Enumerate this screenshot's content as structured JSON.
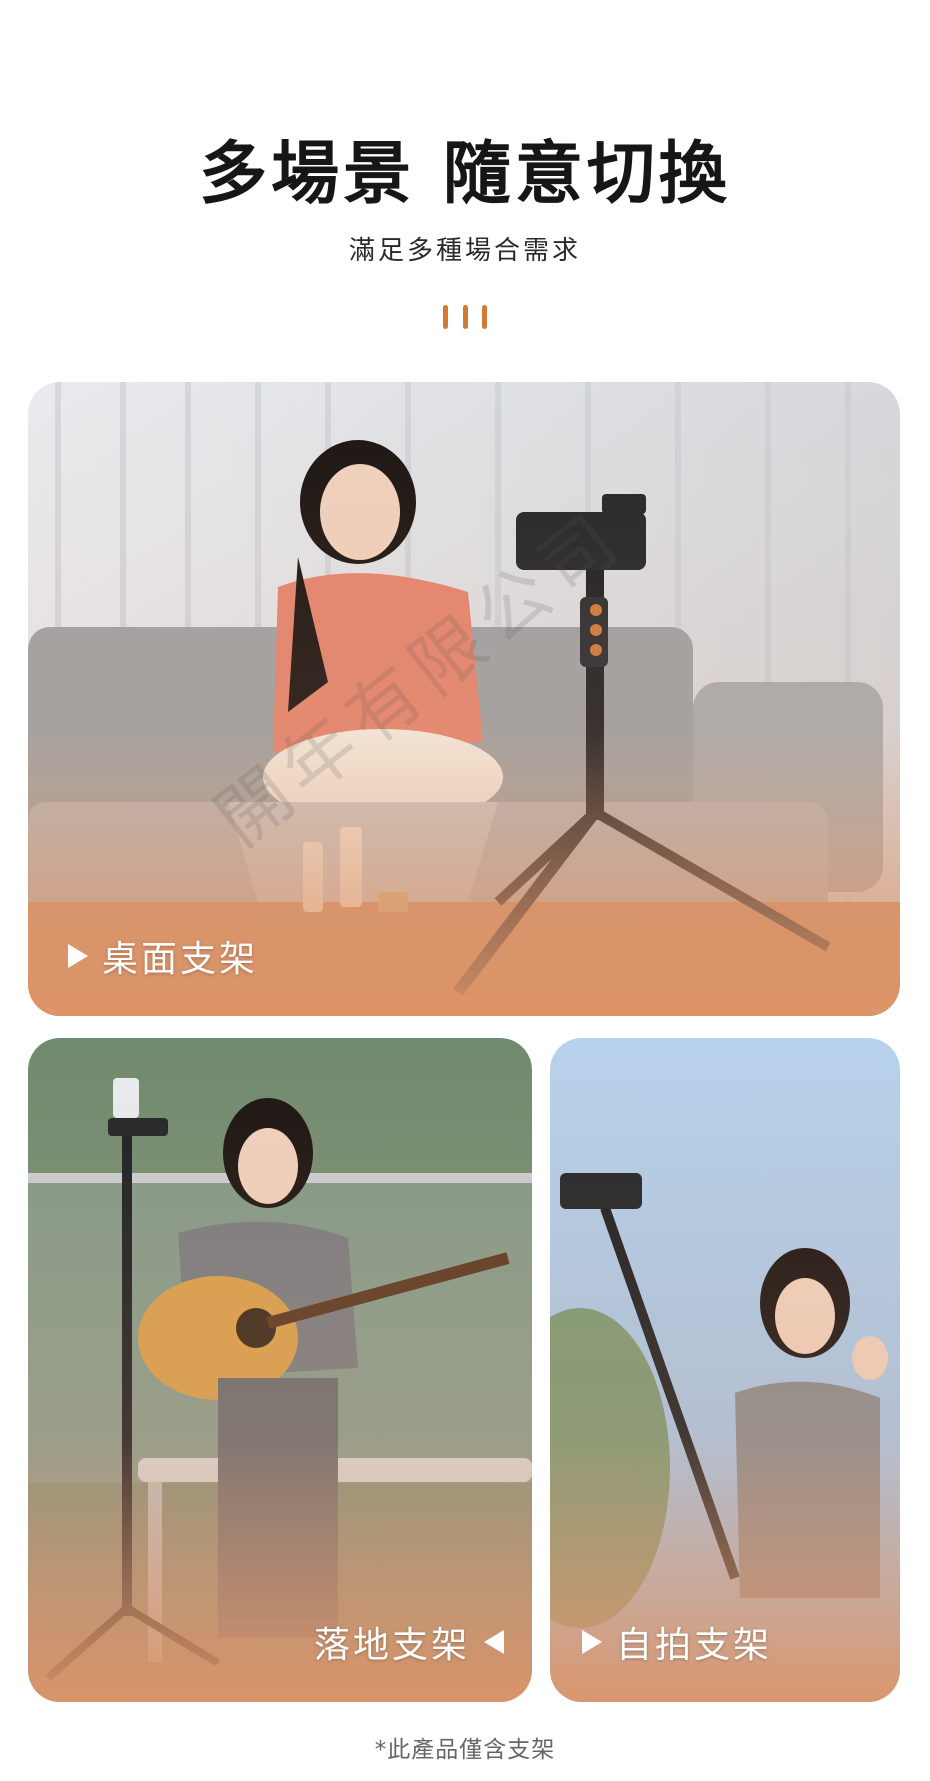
{
  "header": {
    "title": "多場景 隨意切換",
    "subtitle": "滿足多種場合需求"
  },
  "cards": [
    {
      "label": "桌面支架"
    },
    {
      "label": "落地支架"
    },
    {
      "label": "自拍支架"
    }
  ],
  "footnote": "*此產品僅含支架",
  "watermark": "開年有限公司",
  "colors": {
    "accent": "#d17a34",
    "card_gradient_warm": "#e0a078"
  },
  "icons": {
    "divider": "three-vertical-bars",
    "label_arrow_right": "play-triangle-right",
    "label_arrow_left": "play-triangle-left"
  }
}
